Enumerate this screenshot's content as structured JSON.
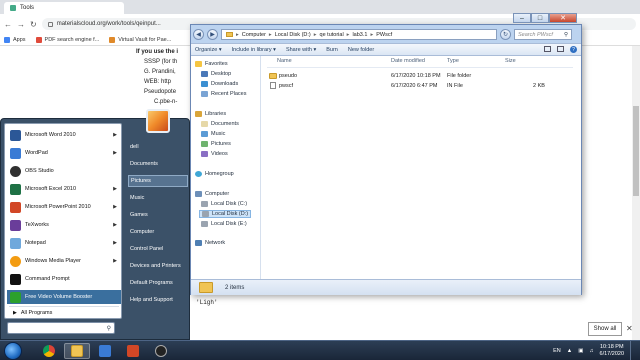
{
  "browser": {
    "tab_title": "Tools",
    "url": "materialscloud.org/work/tools/qeinput...",
    "bookmarks": [
      {
        "label": "Apps",
        "color": "#4285f4"
      },
      {
        "label": "PDF search engine f...",
        "color": "#e04b3b"
      },
      {
        "label": "Virtual Vault for Pae...",
        "color": "#e08a2a"
      }
    ],
    "page_lines": [
      "If you use the i",
      "SSSP (for th",
      "G. Prandini,",
      "WEB: http",
      "Pseudopote",
      "C.pbe-n-",
      "'Ligh'"
    ],
    "show_all": "Show all"
  },
  "explorer": {
    "path": [
      "Computer",
      "Local Disk (D:)",
      "qe tutorial",
      "lab3.1",
      "PWscf"
    ],
    "search_placeholder": "Search PWscf",
    "toolbar": [
      "Organize ▾",
      "Include in library ▾",
      "Share with ▾",
      "Burn",
      "New folder"
    ],
    "nav": {
      "favorites": "Favorites",
      "desktop": "Desktop",
      "downloads": "Downloads",
      "recent": "Recent Places",
      "libraries": "Libraries",
      "documents": "Documents",
      "music": "Music",
      "pictures": "Pictures",
      "videos": "Videos",
      "homegroup": "Homegroup",
      "computer": "Computer",
      "disk_c": "Local Disk (C:)",
      "disk_d": "Local Disk (D:)",
      "disk_e": "Local Disk (E:)",
      "network": "Network"
    },
    "columns": {
      "name": "Name",
      "date": "Date modified",
      "type": "Type",
      "size": "Size"
    },
    "files": [
      {
        "name": "pseudo",
        "date": "6/17/2020 10:18 PM",
        "type": "File folder",
        "size": "",
        "kind": "folder"
      },
      {
        "name": "pwscf",
        "date": "6/17/2020 6:47 PM",
        "type": "IN File",
        "size": "2 KB",
        "kind": "file"
      }
    ],
    "status": "2 items"
  },
  "startmenu": {
    "programs": [
      {
        "label": "Microsoft Word 2010",
        "color": "#2b5797",
        "arrow": true
      },
      {
        "label": "WordPad",
        "color": "#3a7bd5",
        "arrow": true
      },
      {
        "label": "OBS Studio",
        "color": "#303030",
        "arrow": false
      },
      {
        "label": "Microsoft Excel 2010",
        "color": "#1e7145",
        "arrow": true
      },
      {
        "label": "Microsoft PowerPoint 2010",
        "color": "#d24726",
        "arrow": true
      },
      {
        "label": "TeXworks",
        "color": "#6a3d9a",
        "arrow": true
      },
      {
        "label": "Notepad",
        "color": "#6fa8dc",
        "arrow": true
      },
      {
        "label": "Windows Media Player",
        "color": "#f39c12",
        "arrow": true
      },
      {
        "label": "Command Prompt",
        "color": "#111111",
        "arrow": false
      },
      {
        "label": "Free Video Volume Booster",
        "color": "#2ca02c",
        "arrow": false
      }
    ],
    "all_programs": "All Programs",
    "right_links": [
      "dell",
      "Documents",
      "Pictures",
      "Music",
      "Games",
      "Computer",
      "Control Panel",
      "Devices and Printers",
      "Default Programs",
      "Help and Support"
    ]
  },
  "taskbar": {
    "apps": [
      "chrome",
      "explorer",
      "media",
      "powerpoint",
      "obs"
    ],
    "lang": "EN",
    "time": "10:18 PM",
    "date": "6/17/2020"
  }
}
